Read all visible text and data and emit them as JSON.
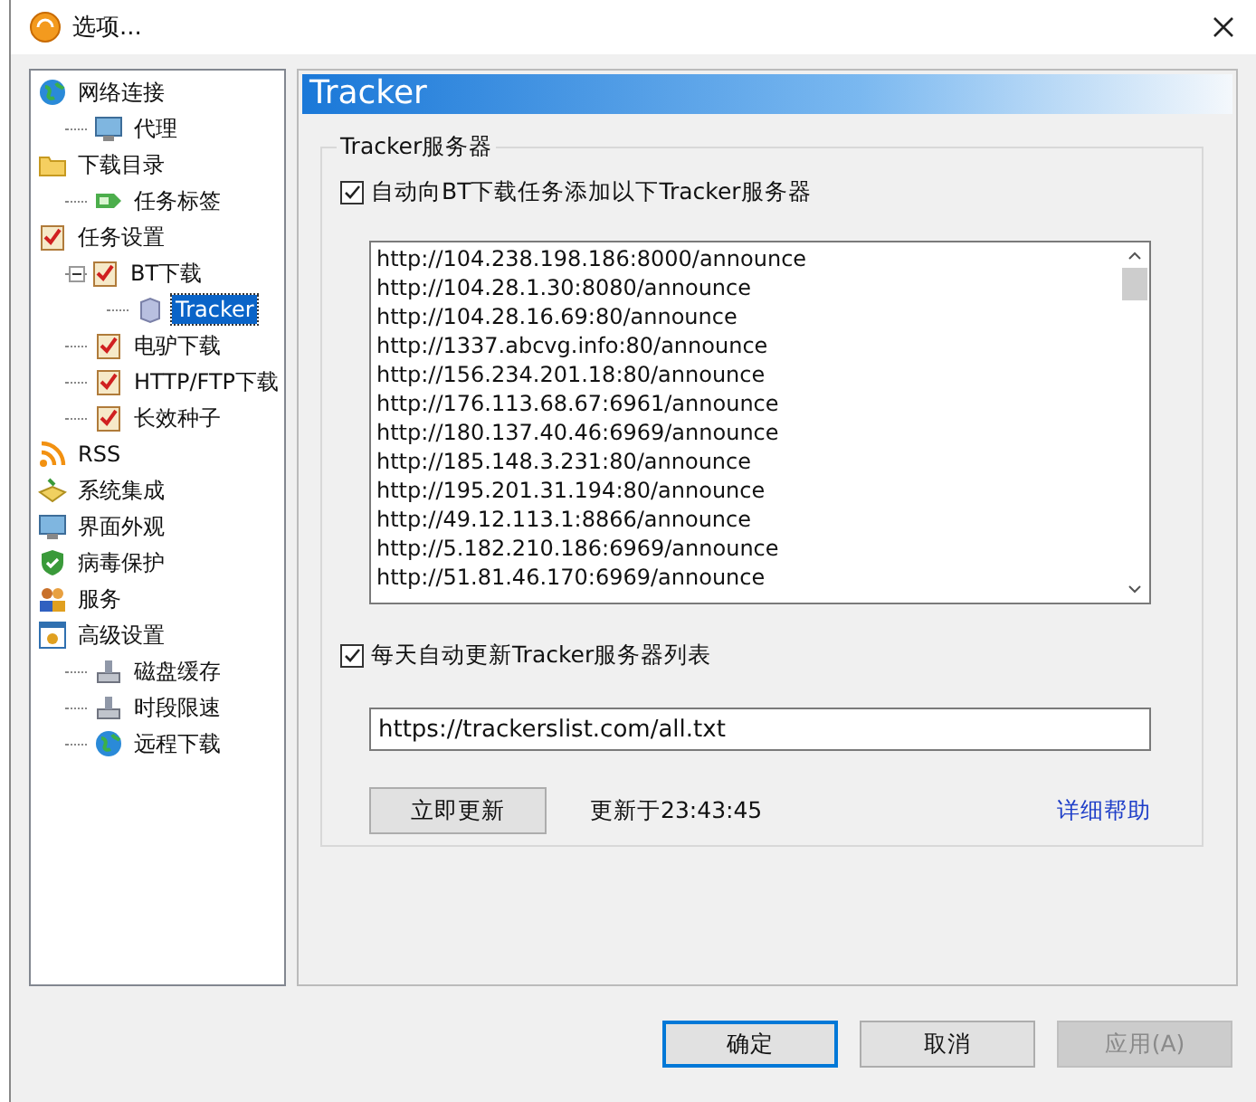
{
  "window": {
    "title": "选项..."
  },
  "sidebar": {
    "items": [
      {
        "label": "网络连接",
        "selected": false,
        "children": [
          {
            "label": "代理",
            "selected": false
          }
        ]
      },
      {
        "label": "下载目录",
        "selected": false,
        "children": [
          {
            "label": "任务标签",
            "selected": false
          }
        ]
      },
      {
        "label": "任务设置",
        "selected": false,
        "children": [
          {
            "label": "BT下载",
            "selected": false,
            "expanded": true,
            "children": [
              {
                "label": "Tracker",
                "selected": true
              }
            ]
          },
          {
            "label": "电驴下载",
            "selected": false
          },
          {
            "label": "HTTP/FTP下载",
            "selected": false
          },
          {
            "label": "长效种子",
            "selected": false
          }
        ]
      },
      {
        "label": "RSS",
        "selected": false
      },
      {
        "label": "系统集成",
        "selected": false
      },
      {
        "label": "界面外观",
        "selected": false
      },
      {
        "label": "病毒保护",
        "selected": false
      },
      {
        "label": "服务",
        "selected": false
      },
      {
        "label": "高级设置",
        "selected": false,
        "children": [
          {
            "label": "磁盘缓存",
            "selected": false
          },
          {
            "label": "时段限速",
            "selected": false
          },
          {
            "label": "远程下载",
            "selected": false
          }
        ]
      }
    ]
  },
  "panel": {
    "title": "Tracker",
    "group_title": "Tracker服务器",
    "auto_add": {
      "label": "自动向BT下载任务添加以下Tracker服务器",
      "checked": true
    },
    "trackers": [
      "http://104.238.198.186:8000/announce",
      "http://104.28.1.30:8080/announce",
      "http://104.28.16.69:80/announce",
      "http://1337.abcvg.info:80/announce",
      "http://156.234.201.18:80/announce",
      "http://176.113.68.67:6961/announce",
      "http://180.137.40.46:6969/announce",
      "http://185.148.3.231:80/announce",
      "http://195.201.31.194:80/announce",
      "http://49.12.113.1:8866/announce",
      "http://5.182.210.186:6969/announce",
      "http://51.81.46.170:6969/announce"
    ],
    "auto_update": {
      "label": "每天自动更新Tracker服务器列表",
      "checked": true
    },
    "url": "https://trackerslist.com/all.txt",
    "update_button": "立即更新",
    "updated_at": "更新于23:43:45",
    "help_link": "详细帮助"
  },
  "buttons": [
    {
      "label": "确定",
      "disabled": false,
      "default": true
    },
    {
      "label": "取消",
      "disabled": false,
      "default": false
    },
    {
      "label": "应用(A)",
      "disabled": true,
      "default": false
    }
  ]
}
